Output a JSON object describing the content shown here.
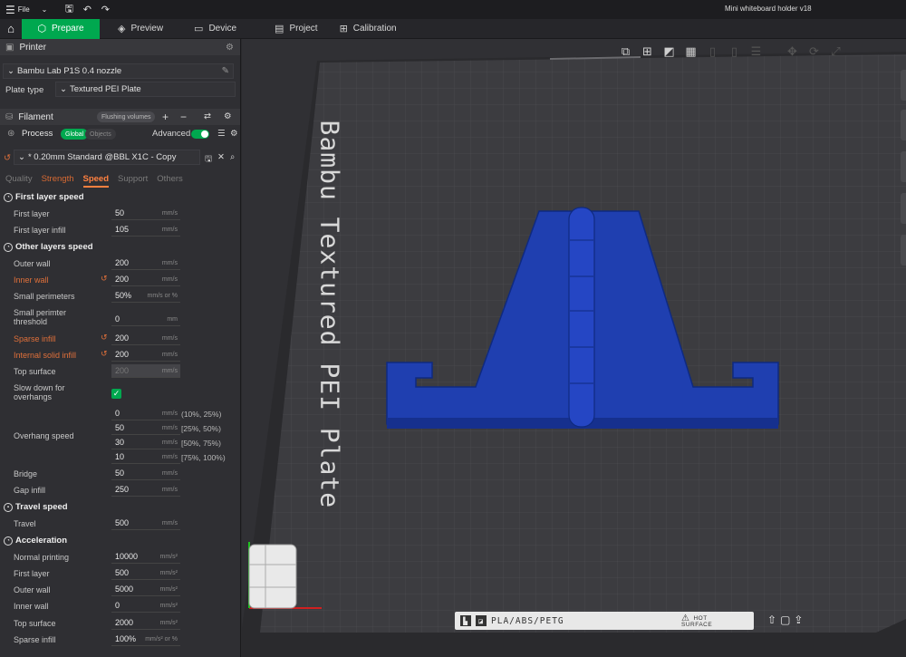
{
  "titlebar": {
    "file_label": "File",
    "window_title": "Mini whiteboard holder v18"
  },
  "tabs": [
    {
      "label": "Prepare",
      "icon": "cube-icon"
    },
    {
      "label": "Preview",
      "icon": "layers-icon"
    },
    {
      "label": "Device",
      "icon": "monitor-icon"
    },
    {
      "label": "Project",
      "icon": "document-icon"
    },
    {
      "label": "Calibration",
      "icon": "calibration-icon"
    }
  ],
  "printer": {
    "header": "Printer",
    "selected": "Bambu Lab P1S 0.4 nozzle",
    "plate_type_label": "Plate type",
    "plate_type_value": "Textured PEI Plate"
  },
  "filament": {
    "header": "Filament",
    "flushing_label": "Flushing volumes"
  },
  "process": {
    "header": "Process",
    "global_label": "Global",
    "objects_label": "Objects",
    "advanced_label": "Advanced",
    "advanced_on": true,
    "preset": "* 0.20mm Standard @BBL X1C - Copy"
  },
  "subtabs": [
    "Quality",
    "Strength",
    "Speed",
    "Support",
    "Others"
  ],
  "sections": {
    "first_layer_speed": "First layer speed",
    "other_layers_speed": "Other layers speed",
    "travel_speed": "Travel speed",
    "acceleration": "Acceleration"
  },
  "settings": {
    "first_layer": {
      "label": "First layer",
      "value": "50",
      "unit": "mm/s"
    },
    "first_layer_infill": {
      "label": "First layer infill",
      "value": "105",
      "unit": "mm/s"
    },
    "outer_wall": {
      "label": "Outer wall",
      "value": "200",
      "unit": "mm/s"
    },
    "inner_wall": {
      "label": "Inner wall",
      "value": "200",
      "unit": "mm/s"
    },
    "small_perimeters": {
      "label": "Small perimeters",
      "value": "50%",
      "unit": "mm/s or %"
    },
    "small_perimeter_threshold": {
      "label": "Small perimter threshold",
      "value": "0",
      "unit": "mm"
    },
    "sparse_infill": {
      "label": "Sparse infill",
      "value": "200",
      "unit": "mm/s"
    },
    "internal_solid_infill": {
      "label": "Internal solid infill",
      "value": "200",
      "unit": "mm/s"
    },
    "top_surface": {
      "label": "Top surface",
      "value": "200",
      "unit": "mm/s"
    },
    "slow_down_overhangs": {
      "label": "Slow down for overhangs",
      "checked": true
    },
    "overhang_speed": {
      "label": "Overhang speed",
      "rows": [
        {
          "value": "0",
          "unit": "mm/s",
          "range": "(10%, 25%)"
        },
        {
          "value": "50",
          "unit": "mm/s",
          "range": "[25%, 50%)"
        },
        {
          "value": "30",
          "unit": "mm/s",
          "range": "[50%, 75%)"
        },
        {
          "value": "10",
          "unit": "mm/s",
          "range": "[75%, 100%)"
        }
      ]
    },
    "bridge": {
      "label": "Bridge",
      "value": "50",
      "unit": "mm/s"
    },
    "gap_infill": {
      "label": "Gap infill",
      "value": "250",
      "unit": "mm/s"
    },
    "travel": {
      "label": "Travel",
      "value": "500",
      "unit": "mm/s"
    },
    "normal_printing": {
      "label": "Normal printing",
      "value": "10000",
      "unit": "mm/s²"
    },
    "accel_first_layer": {
      "label": "First layer",
      "value": "500",
      "unit": "mm/s²"
    },
    "accel_outer_wall": {
      "label": "Outer wall",
      "value": "5000",
      "unit": "mm/s²"
    },
    "accel_inner_wall": {
      "label": "Inner wall",
      "value": "0",
      "unit": "mm/s²"
    },
    "accel_top_surface": {
      "label": "Top surface",
      "value": "2000",
      "unit": "mm/s²"
    },
    "accel_sparse_infill": {
      "label": "Sparse infill",
      "value": "100%",
      "unit": "mm/s² or %"
    }
  },
  "viewport": {
    "plate_text": "Bambu Textured PEI Plate",
    "material_text": "PLA/ABS/PETG",
    "hot_surface_text": "HOT SURFACE",
    "model_color": "#1f3fb0",
    "accent_color": "#00a84f",
    "modified_color": "#e0703a"
  }
}
